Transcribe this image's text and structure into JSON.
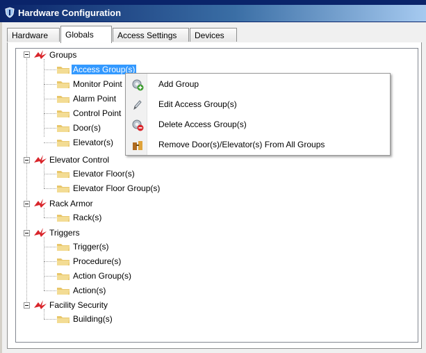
{
  "window": {
    "title": "Hardware Configuration"
  },
  "tabs": [
    {
      "label": "Hardware"
    },
    {
      "label": "Globals"
    },
    {
      "label": "Access Settings"
    },
    {
      "label": "Devices"
    }
  ],
  "tree": {
    "groups": {
      "label": "Groups",
      "children": [
        "Access Group(s)",
        "Monitor Point",
        "Alarm Point",
        "Control Point",
        "Door(s)",
        "Elevator(s)"
      ]
    },
    "elevator_control": {
      "label": "Elevator Control",
      "children": [
        "Elevator Floor(s)",
        "Elevator Floor Group(s)"
      ]
    },
    "rack_armor": {
      "label": "Rack Armor",
      "children": [
        "Rack(s)"
      ]
    },
    "triggers": {
      "label": "Triggers",
      "children": [
        "Trigger(s)",
        "Procedure(s)",
        "Action Group(s)",
        "Action(s)"
      ]
    },
    "facility_security": {
      "label": "Facility Security",
      "children": [
        "Building(s)"
      ]
    }
  },
  "context_menu": {
    "items": [
      {
        "label": "Add Group",
        "icon": "gear-add-icon"
      },
      {
        "label": "Edit Access Group(s)",
        "icon": "edit-icon"
      },
      {
        "label": "Delete Access Group(s)",
        "icon": "gear-delete-icon"
      },
      {
        "label": "Remove Door(s)/Elevator(s) From All Groups",
        "icon": "remove-icon"
      }
    ]
  },
  "colors": {
    "titlebar": "#0a246a",
    "selection": "#3399ff",
    "node_icon": "#d9252b",
    "folder": "#e8c66a"
  }
}
